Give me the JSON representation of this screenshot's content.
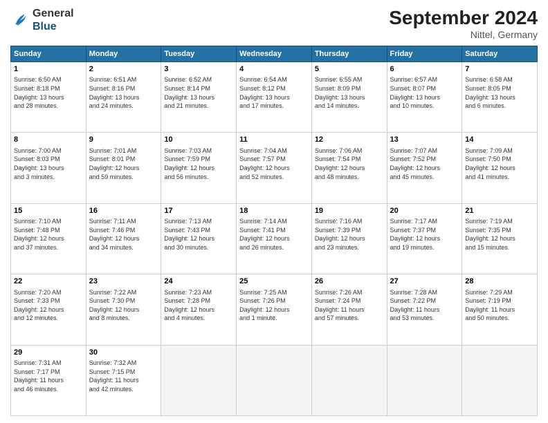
{
  "header": {
    "logo_line1": "General",
    "logo_line2": "Blue",
    "month": "September 2024",
    "location": "Nittel, Germany"
  },
  "days_of_week": [
    "Sunday",
    "Monday",
    "Tuesday",
    "Wednesday",
    "Thursday",
    "Friday",
    "Saturday"
  ],
  "weeks": [
    [
      {
        "day": "1",
        "info": "Sunrise: 6:50 AM\nSunset: 8:18 PM\nDaylight: 13 hours\nand 28 minutes."
      },
      {
        "day": "2",
        "info": "Sunrise: 6:51 AM\nSunset: 8:16 PM\nDaylight: 13 hours\nand 24 minutes."
      },
      {
        "day": "3",
        "info": "Sunrise: 6:52 AM\nSunset: 8:14 PM\nDaylight: 13 hours\nand 21 minutes."
      },
      {
        "day": "4",
        "info": "Sunrise: 6:54 AM\nSunset: 8:12 PM\nDaylight: 13 hours\nand 17 minutes."
      },
      {
        "day": "5",
        "info": "Sunrise: 6:55 AM\nSunset: 8:09 PM\nDaylight: 13 hours\nand 14 minutes."
      },
      {
        "day": "6",
        "info": "Sunrise: 6:57 AM\nSunset: 8:07 PM\nDaylight: 13 hours\nand 10 minutes."
      },
      {
        "day": "7",
        "info": "Sunrise: 6:58 AM\nSunset: 8:05 PM\nDaylight: 13 hours\nand 6 minutes."
      }
    ],
    [
      {
        "day": "8",
        "info": "Sunrise: 7:00 AM\nSunset: 8:03 PM\nDaylight: 13 hours\nand 3 minutes."
      },
      {
        "day": "9",
        "info": "Sunrise: 7:01 AM\nSunset: 8:01 PM\nDaylight: 12 hours\nand 59 minutes."
      },
      {
        "day": "10",
        "info": "Sunrise: 7:03 AM\nSunset: 7:59 PM\nDaylight: 12 hours\nand 56 minutes."
      },
      {
        "day": "11",
        "info": "Sunrise: 7:04 AM\nSunset: 7:57 PM\nDaylight: 12 hours\nand 52 minutes."
      },
      {
        "day": "12",
        "info": "Sunrise: 7:06 AM\nSunset: 7:54 PM\nDaylight: 12 hours\nand 48 minutes."
      },
      {
        "day": "13",
        "info": "Sunrise: 7:07 AM\nSunset: 7:52 PM\nDaylight: 12 hours\nand 45 minutes."
      },
      {
        "day": "14",
        "info": "Sunrise: 7:09 AM\nSunset: 7:50 PM\nDaylight: 12 hours\nand 41 minutes."
      }
    ],
    [
      {
        "day": "15",
        "info": "Sunrise: 7:10 AM\nSunset: 7:48 PM\nDaylight: 12 hours\nand 37 minutes."
      },
      {
        "day": "16",
        "info": "Sunrise: 7:11 AM\nSunset: 7:46 PM\nDaylight: 12 hours\nand 34 minutes."
      },
      {
        "day": "17",
        "info": "Sunrise: 7:13 AM\nSunset: 7:43 PM\nDaylight: 12 hours\nand 30 minutes."
      },
      {
        "day": "18",
        "info": "Sunrise: 7:14 AM\nSunset: 7:41 PM\nDaylight: 12 hours\nand 26 minutes."
      },
      {
        "day": "19",
        "info": "Sunrise: 7:16 AM\nSunset: 7:39 PM\nDaylight: 12 hours\nand 23 minutes."
      },
      {
        "day": "20",
        "info": "Sunrise: 7:17 AM\nSunset: 7:37 PM\nDaylight: 12 hours\nand 19 minutes."
      },
      {
        "day": "21",
        "info": "Sunrise: 7:19 AM\nSunset: 7:35 PM\nDaylight: 12 hours\nand 15 minutes."
      }
    ],
    [
      {
        "day": "22",
        "info": "Sunrise: 7:20 AM\nSunset: 7:33 PM\nDaylight: 12 hours\nand 12 minutes."
      },
      {
        "day": "23",
        "info": "Sunrise: 7:22 AM\nSunset: 7:30 PM\nDaylight: 12 hours\nand 8 minutes."
      },
      {
        "day": "24",
        "info": "Sunrise: 7:23 AM\nSunset: 7:28 PM\nDaylight: 12 hours\nand 4 minutes."
      },
      {
        "day": "25",
        "info": "Sunrise: 7:25 AM\nSunset: 7:26 PM\nDaylight: 12 hours\nand 1 minute."
      },
      {
        "day": "26",
        "info": "Sunrise: 7:26 AM\nSunset: 7:24 PM\nDaylight: 11 hours\nand 57 minutes."
      },
      {
        "day": "27",
        "info": "Sunrise: 7:28 AM\nSunset: 7:22 PM\nDaylight: 11 hours\nand 53 minutes."
      },
      {
        "day": "28",
        "info": "Sunrise: 7:29 AM\nSunset: 7:19 PM\nDaylight: 11 hours\nand 50 minutes."
      }
    ],
    [
      {
        "day": "29",
        "info": "Sunrise: 7:31 AM\nSunset: 7:17 PM\nDaylight: 11 hours\nand 46 minutes."
      },
      {
        "day": "30",
        "info": "Sunrise: 7:32 AM\nSunset: 7:15 PM\nDaylight: 11 hours\nand 42 minutes."
      },
      {
        "day": "",
        "info": ""
      },
      {
        "day": "",
        "info": ""
      },
      {
        "day": "",
        "info": ""
      },
      {
        "day": "",
        "info": ""
      },
      {
        "day": "",
        "info": ""
      }
    ]
  ]
}
